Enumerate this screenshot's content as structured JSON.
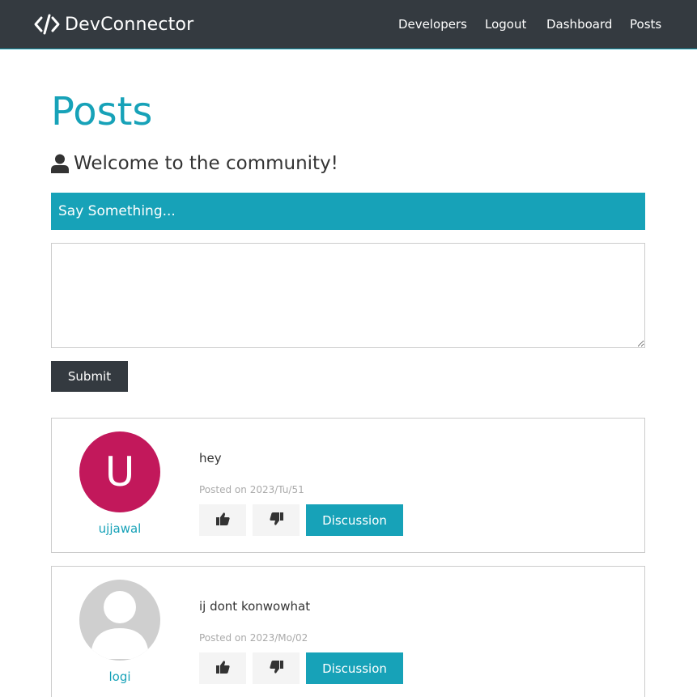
{
  "navbar": {
    "brand": "DevConnector",
    "brand_icon": "code-icon",
    "links": [
      "Developers",
      "Logout",
      "Dashboard",
      "Posts"
    ]
  },
  "page": {
    "title": "Posts",
    "lead": "Welcome to the community!",
    "lead_icon": "user-icon"
  },
  "form": {
    "header": "Say Something...",
    "textarea_value": "",
    "submit_label": "Submit"
  },
  "posts": [
    {
      "avatar_letter": "U",
      "avatar_color": "#c2185b",
      "username": "ujjawal",
      "text": "hey",
      "date_prefix": "Posted on",
      "date": "2023/Tu/51",
      "discussion_label": "Discussion"
    },
    {
      "avatar_letter": "",
      "username": "logi",
      "text": "ij dont konwowhat",
      "date_prefix": "Posted on",
      "date": "2023/Mo/02",
      "discussion_label": "Discussion"
    }
  ],
  "colors": {
    "primary": "#17a2b8",
    "dark": "#343a40",
    "light": "#f4f4f4"
  }
}
